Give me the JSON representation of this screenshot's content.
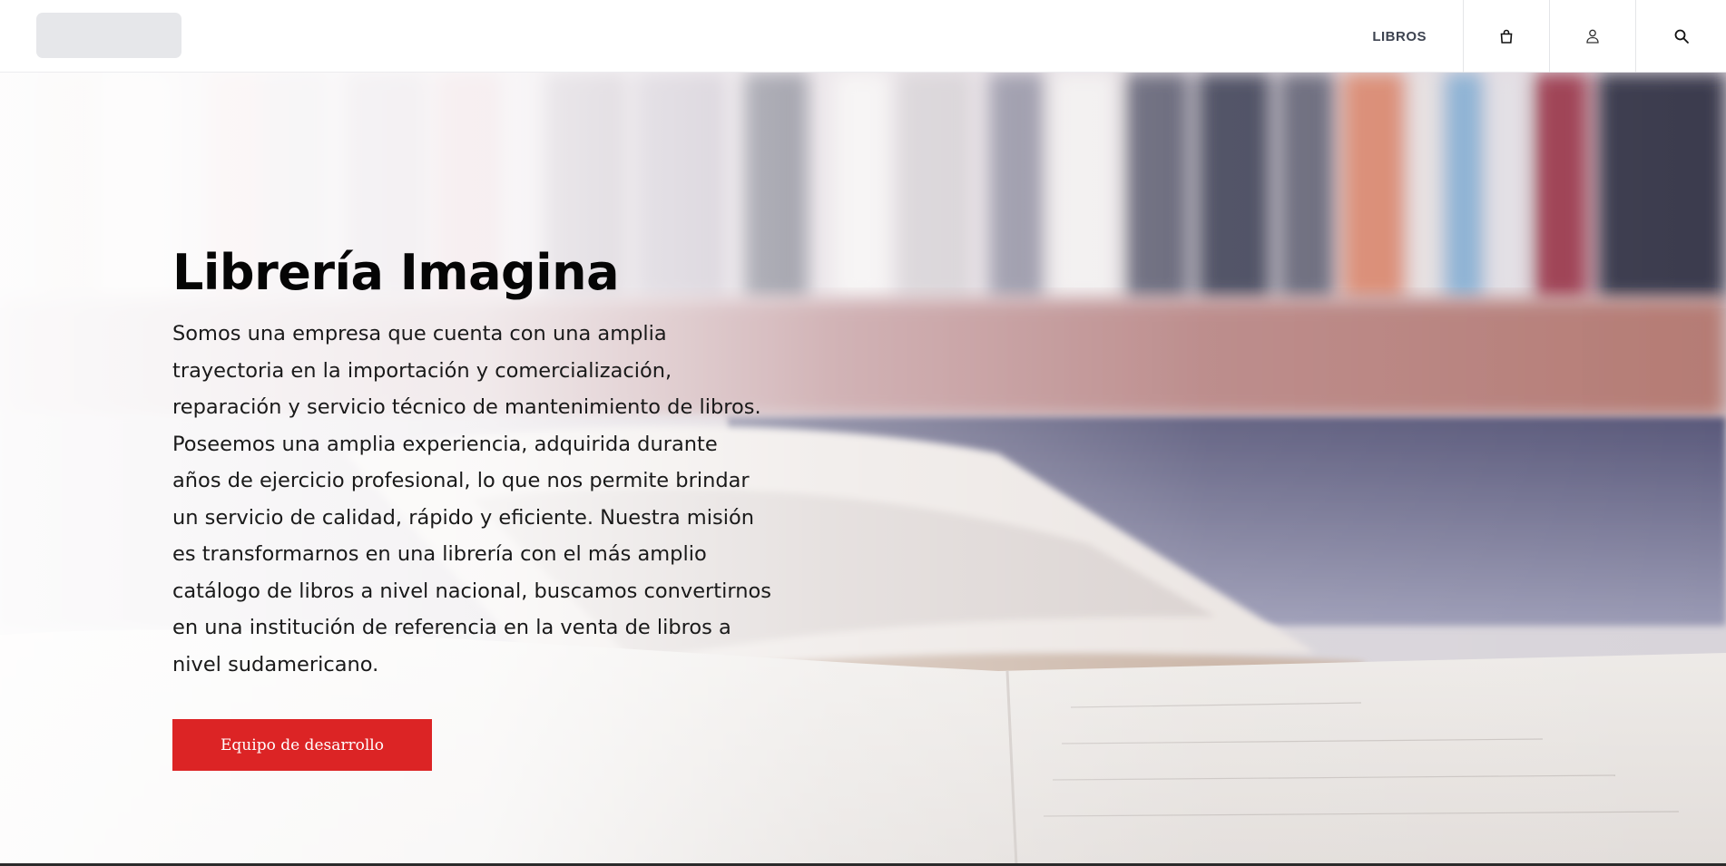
{
  "header": {
    "nav_label": "LIBROS",
    "icons": [
      "shopping-bag-icon",
      "user-icon",
      "search-icon"
    ]
  },
  "hero": {
    "title": "Librería Imagina",
    "paragraph": "Somos una empresa que cuenta con una amplia trayectoria en la importación y comercialización, reparación y servicio técnico de mantenimiento de libros. Poseemos una amplia experiencia, adquirida durante años de ejercicio profesional, lo que nos permite brindar un servicio de calidad, rápido y eficiente. Nuestra misión es transformarnos en una librería con el más amplio catálogo de libros a nivel nacional, buscamos convertirnos en una institución de referencia en la venta de libros a nivel sudamericano.",
    "button_label": "Equipo de desarrollo"
  },
  "colors": {
    "accent": "#dc2425",
    "nav_text": "#3d4350"
  }
}
